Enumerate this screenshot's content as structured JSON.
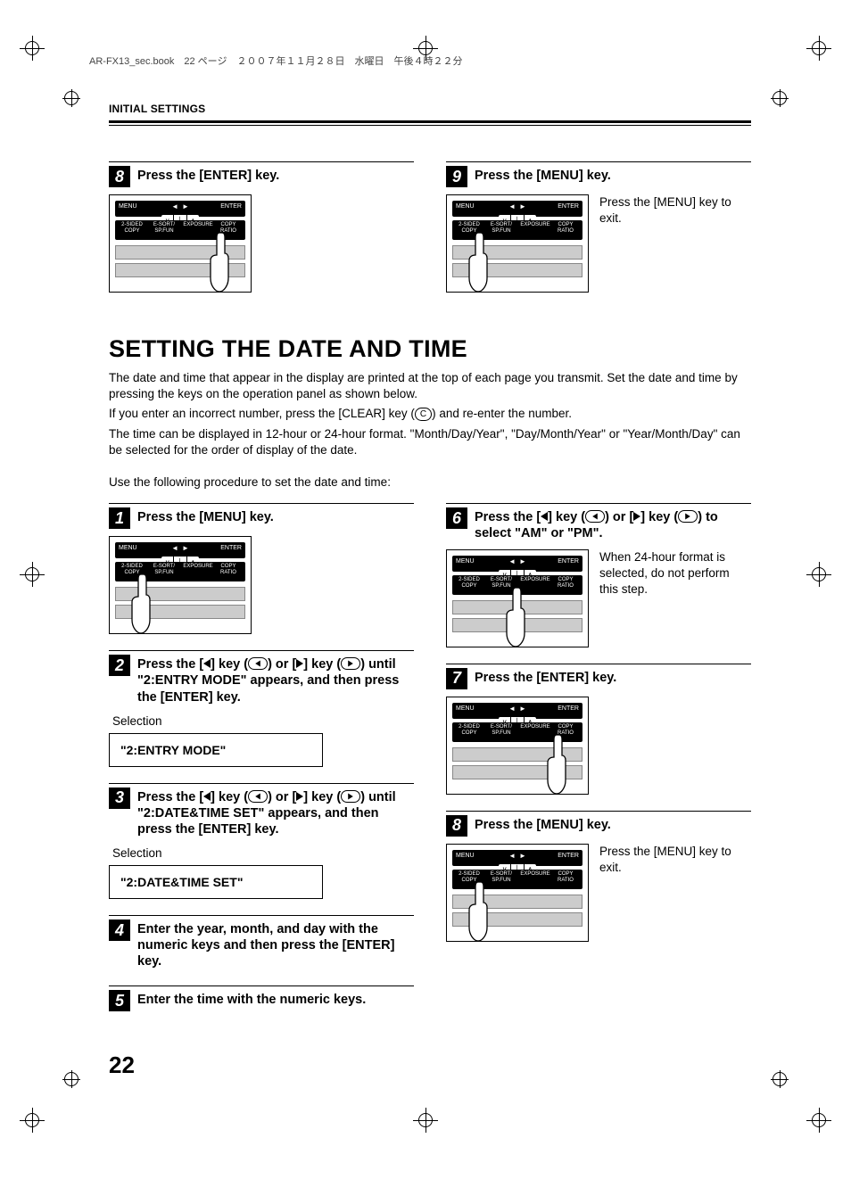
{
  "meta": {
    "header_note": "AR-FX13_sec.book　22 ページ　２００７年１１月２８日　水曜日　午後４時２２分"
  },
  "running_head": "INITIAL SETTINGS",
  "page_number": "22",
  "top_left": {
    "step_num": "8",
    "title": "Press the [ENTER] key."
  },
  "top_right": {
    "step_num": "9",
    "title": "Press the [MENU] key.",
    "note": "Press the [MENU] key to exit."
  },
  "section": {
    "title": "SETTING THE DATE AND TIME",
    "p1": "The date and time that appear in the display are printed at the top of each page you transmit. Set the date and time by pressing the keys on the operation panel as shown below.",
    "p2_a": "If you enter an incorrect number, press the [CLEAR] key (",
    "p2_key": "C",
    "p2_b": ") and re-enter the number.",
    "p3": "The time can be displayed in 12-hour or 24-hour format. \"Month/Day/Year\", \"Day/Month/Year\" or \"Year/Month/Day\" can be selected for the order of display of the date.",
    "p4": "Use the following procedure to set the date and time:"
  },
  "left_steps": {
    "s1": {
      "num": "1",
      "title": "Press the [MENU] key."
    },
    "s2": {
      "num": "2",
      "title_a": "Press the [",
      "title_b": "] key (",
      "title_c": ") or [",
      "title_d": "] key (",
      "title_e": ") until \"2:ENTRY MODE\" appears, and then press the [ENTER] key.",
      "sel_label": "Selection",
      "lcd": "\"2:ENTRY MODE\""
    },
    "s3": {
      "num": "3",
      "title_a": "Press the [",
      "title_b": "] key (",
      "title_c": ") or [",
      "title_d": "] key (",
      "title_e": ") until \"2:DATE&TIME SET\" appears, and then press the [ENTER] key.",
      "sel_label": "Selection",
      "lcd": "\"2:DATE&TIME SET\""
    },
    "s4": {
      "num": "4",
      "title": "Enter the year, month, and day with the numeric keys and then press the [ENTER] key."
    },
    "s5": {
      "num": "5",
      "title": "Enter the time with the numeric keys."
    }
  },
  "right_steps": {
    "s6": {
      "num": "6",
      "title_a": "Press the [",
      "title_b": "] key (",
      "title_c": ") or [",
      "title_d": "] key (",
      "title_e": ") to select \"AM\" or \"PM\".",
      "note": "When 24-hour format is selected, do not perform this step."
    },
    "s7": {
      "num": "7",
      "title": "Press the [ENTER] key."
    },
    "s8": {
      "num": "8",
      "title": "Press the [MENU] key.",
      "note": "Press the [MENU] key to exit."
    }
  },
  "panel_labels": {
    "menu": "MENU",
    "enter": "ENTER",
    "c1": "2-SIDED COPY",
    "c2": "E-SORT/ SP.FUN",
    "c3": "EXPOSURE",
    "c4": "COPY RATIO"
  }
}
